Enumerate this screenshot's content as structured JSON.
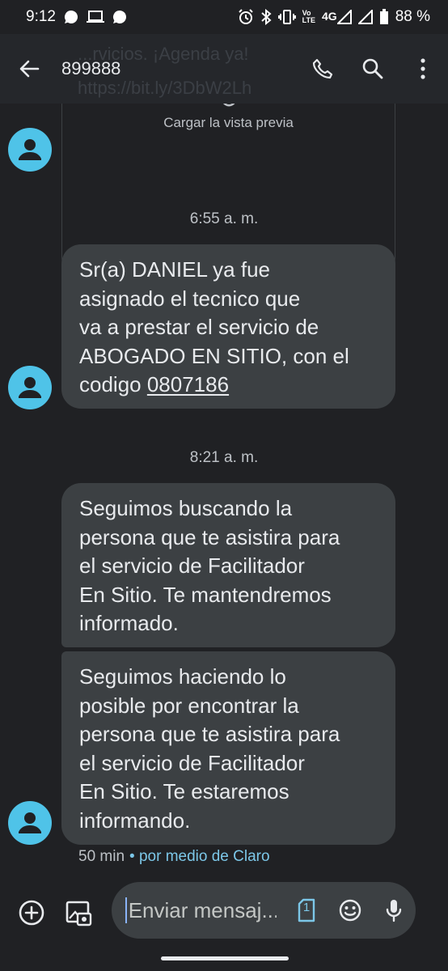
{
  "status_bar": {
    "time": "9:12",
    "battery": "88 %",
    "network": "4G",
    "volte_top": "Vo",
    "volte_bottom": "LTE"
  },
  "app_bar": {
    "title": "899888",
    "ghost_line1": "...rvicios. ¡Agenda ya!",
    "ghost_line2": "https://bit.ly/3DbW2Lh"
  },
  "preview": {
    "label": "Cargar la vista previa"
  },
  "messages": {
    "ts1": "6:55 a. m.",
    "m1_lines": [
      "Sr(a) DANIEL ya fue",
      "asignado el tecnico que",
      "va a prestar el servicio de",
      "ABOGADO EN SITIO, con el"
    ],
    "m1_last_prefix": "codigo ",
    "m1_code": "0807186",
    "ts2": "8:21 a. m.",
    "m2_lines": [
      "Seguimos buscando la",
      "persona que te asistira para",
      "el servicio de Facilitador",
      "En Sitio. Te mantendremos",
      "informado."
    ],
    "m3_lines": [
      "Seguimos haciendo lo",
      "posible por encontrar la",
      "persona que te asistira para",
      "el servicio de Facilitador",
      "En Sitio. Te estaremos",
      "informando."
    ],
    "meta_time": "50 min",
    "meta_via": "• por medio de Claro"
  },
  "compose": {
    "placeholder": "Enviar mensaj...",
    "sim_number": "1"
  },
  "colors": {
    "background": "#202124",
    "bubble": "#3c4043",
    "avatar": "#4fc3e8",
    "accent": "#7cc7e8"
  }
}
